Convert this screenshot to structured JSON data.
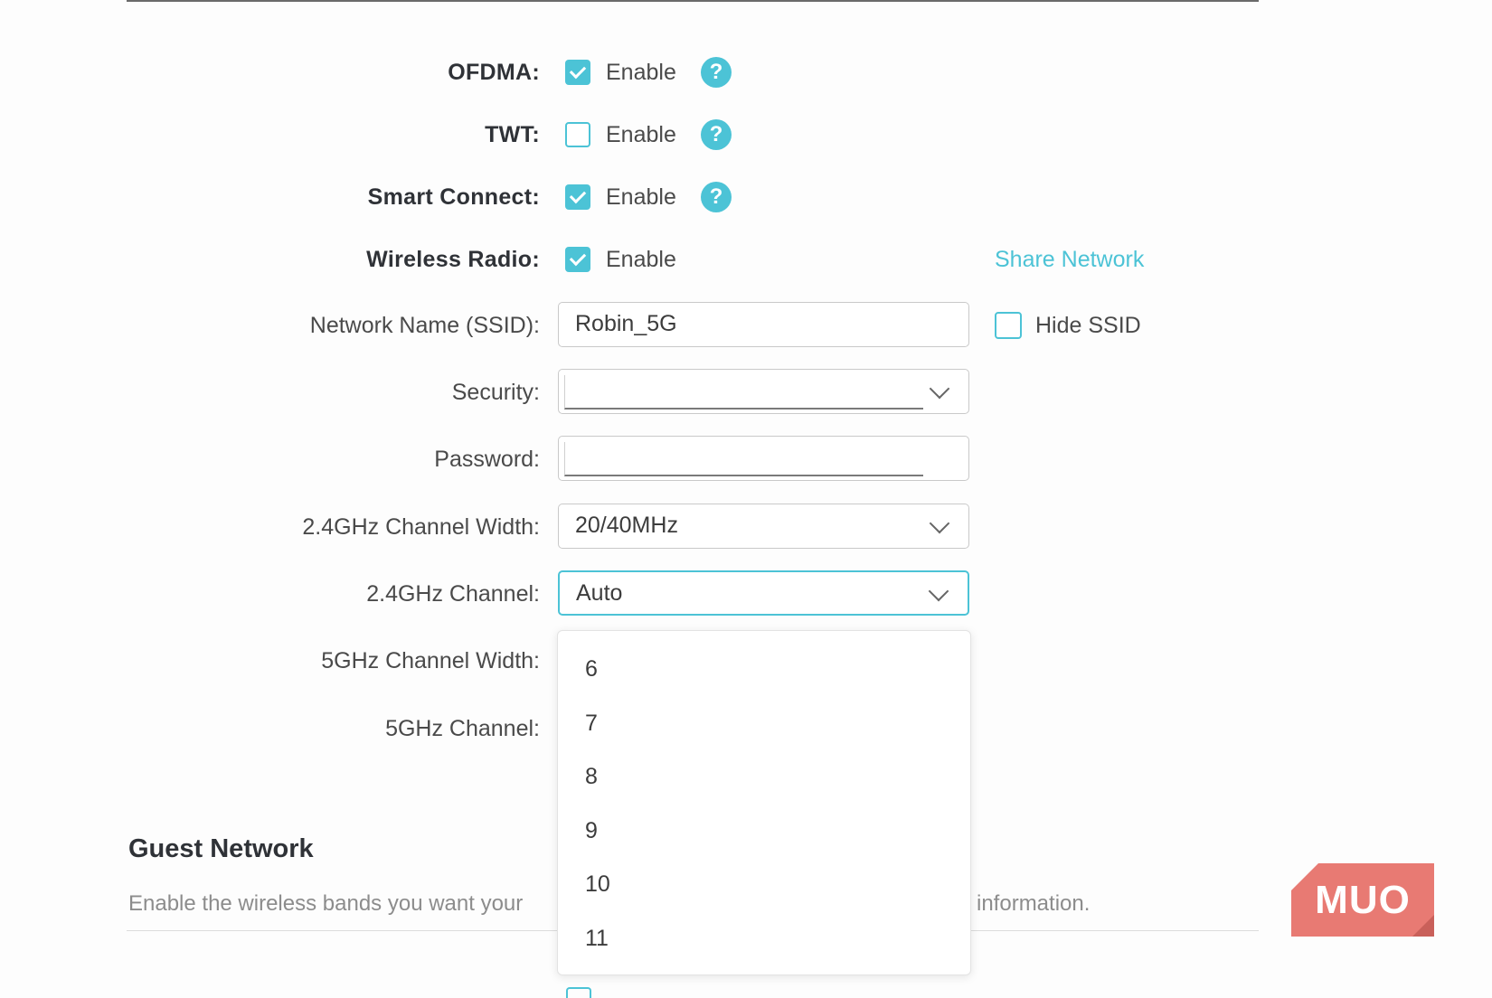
{
  "rows": {
    "ofdma": {
      "label": "OFDMA:",
      "enabled": true,
      "enable_text": "Enable",
      "help": "?"
    },
    "twt": {
      "label": "TWT:",
      "enabled": false,
      "enable_text": "Enable",
      "help": "?"
    },
    "smart_connect": {
      "label": "Smart Connect:",
      "enabled": true,
      "enable_text": "Enable",
      "help": "?"
    },
    "wireless_radio": {
      "label": "Wireless Radio:",
      "enabled": true,
      "enable_text": "Enable"
    }
  },
  "share_network": "Share Network",
  "ssid": {
    "label": "Network Name (SSID):",
    "value": "Robin_5G"
  },
  "hide_ssid": {
    "label": "Hide SSID",
    "checked": false
  },
  "security": {
    "label": "Security:",
    "value": ""
  },
  "password": {
    "label": "Password:",
    "value": ""
  },
  "ch_width_24": {
    "label": "2.4GHz Channel Width:",
    "value": "20/40MHz"
  },
  "channel_24": {
    "label": "2.4GHz Channel:",
    "value": "Auto"
  },
  "ch_width_5": {
    "label": "5GHz Channel Width:"
  },
  "channel_5": {
    "label": "5GHz Channel:"
  },
  "dropdown": {
    "options": [
      "6",
      "7",
      "8",
      "9",
      "10",
      "11"
    ]
  },
  "guest": {
    "title": "Guest Network",
    "desc_left": "Enable the wireless bands you want your",
    "desc_right": "information."
  },
  "watermark": "MUO",
  "colors": {
    "accent": "#4cc3d6",
    "logo": "#e87a73"
  },
  "icons": {
    "help": "help-circle-icon",
    "check": "check-icon",
    "chevron": "chevron-down-icon"
  }
}
